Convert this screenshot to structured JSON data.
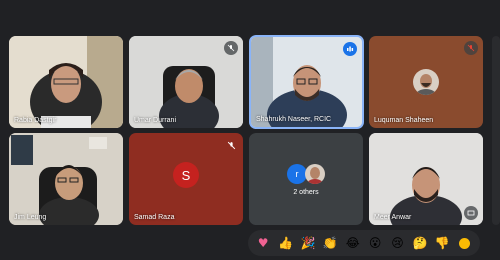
{
  "participants": [
    {
      "name": "Rabia Dastgir"
    },
    {
      "name": "Umar Durrani"
    },
    {
      "name": "Shahrukh Naseer, RCIC"
    },
    {
      "name": "Luquman Shaheen"
    },
    {
      "name": "Jim Leung"
    },
    {
      "name": "Samad Raza",
      "initial": "S"
    },
    {
      "name": "Meer Anwar"
    }
  ],
  "others_tile": {
    "initial": "r",
    "label": "2 others"
  },
  "reactions": [
    "heart-emoji",
    "thumbs-up-emoji",
    "party-popper-emoji",
    "clapping-emoji",
    "joy-emoji",
    "surprised-emoji",
    "sad-emoji",
    "thinking-emoji",
    "thumbs-down-emoji"
  ],
  "colors": {
    "background": "#202124",
    "active_border": "#8ab4f8",
    "avatar_red": "#c5221f",
    "avatar_blue": "#1a73e8",
    "muted_red": "#ea4335"
  }
}
